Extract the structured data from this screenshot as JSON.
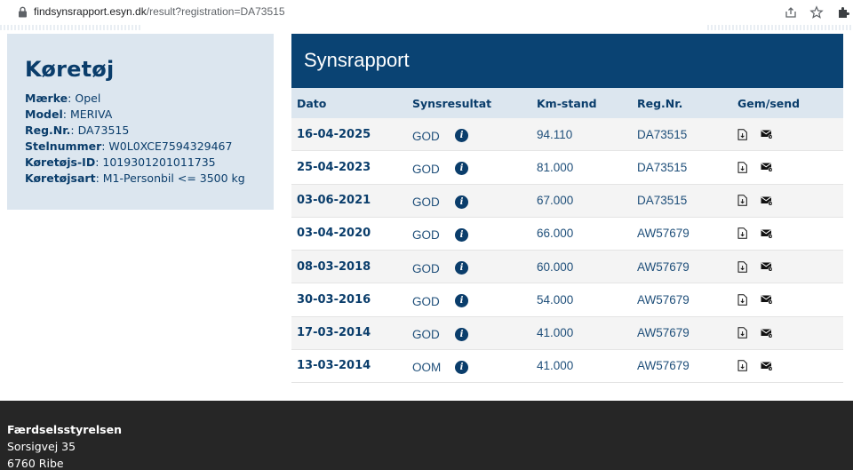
{
  "browser": {
    "url_host": "findsynsrapport.esyn.dk",
    "url_path": "/result?registration=DA73515"
  },
  "vehicle": {
    "title": "Køretøj",
    "fields": [
      {
        "label": "Mærke",
        "value": "Opel"
      },
      {
        "label": "Model",
        "value": "MERIVA"
      },
      {
        "label": "Reg.Nr.",
        "value": "DA73515"
      },
      {
        "label": "Stelnummer",
        "value": "W0L0XCE7594329467"
      },
      {
        "label": "Køretøjs-ID",
        "value": "1019301201011735"
      },
      {
        "label": "Køretøjsart",
        "value": "M1-Personbil <= 3500 kg"
      }
    ]
  },
  "report": {
    "title": "Synsrapport",
    "columns": [
      "Dato",
      "Synsresultat",
      "Km-stand",
      "Reg.Nr.",
      "Gem/send"
    ],
    "rows": [
      {
        "date": "16-04-2025",
        "result": "GOD",
        "km": "94.110",
        "reg": "DA73515"
      },
      {
        "date": "25-04-2023",
        "result": "GOD",
        "km": "81.000",
        "reg": "DA73515"
      },
      {
        "date": "03-06-2021",
        "result": "GOD",
        "km": "67.000",
        "reg": "DA73515"
      },
      {
        "date": "03-04-2020",
        "result": "GOD",
        "km": "66.000",
        "reg": "AW57679"
      },
      {
        "date": "08-03-2018",
        "result": "GOD",
        "km": "60.000",
        "reg": "AW57679"
      },
      {
        "date": "30-03-2016",
        "result": "GOD",
        "km": "54.000",
        "reg": "AW57679"
      },
      {
        "date": "17-03-2014",
        "result": "GOD",
        "km": "41.000",
        "reg": "AW57679"
      },
      {
        "date": "13-03-2014",
        "result": "OOM",
        "km": "41.000",
        "reg": "AW57679"
      }
    ]
  },
  "footer": {
    "org": "Færdselsstyrelsen",
    "street": "Sorsigvej 35",
    "city": "6760 Ribe"
  },
  "colors": {
    "header_blue": "#0a4373",
    "text_blue": "#0a3d6b",
    "panel": "#dce6ef",
    "footer_bg": "#262626"
  },
  "icons": {
    "info": "info-icon",
    "save": "pdf-download-icon",
    "send": "mail-send-icon"
  }
}
